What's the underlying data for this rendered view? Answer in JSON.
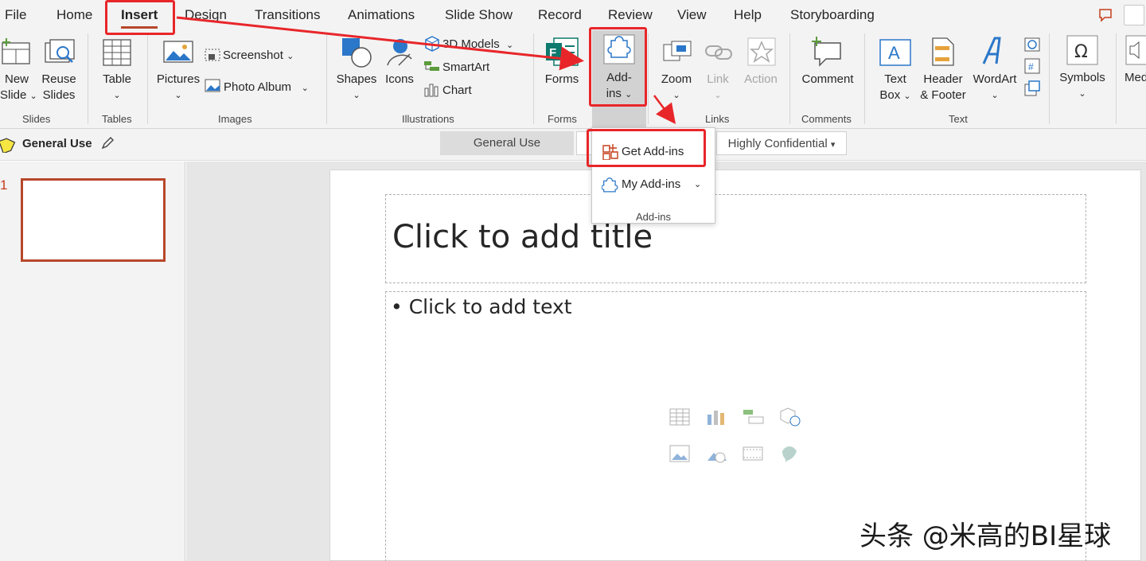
{
  "menubar": {
    "tabs": [
      "File",
      "Home",
      "Insert",
      "Design",
      "Transitions",
      "Animations",
      "Slide Show",
      "Record",
      "Review",
      "View",
      "Help",
      "Storyboarding"
    ],
    "active_tab": "Insert"
  },
  "ribbon": {
    "slides": {
      "new_slide": [
        "New",
        "Slide"
      ],
      "reuse_slides": [
        "Reuse",
        "Slides"
      ],
      "group": "Slides"
    },
    "tables": {
      "table": "Table",
      "group": "Tables"
    },
    "images": {
      "pictures": "Pictures",
      "screenshot": "Screenshot",
      "photo_album": "Photo Album",
      "group": "Images"
    },
    "illustrations": {
      "shapes": "Shapes",
      "icons": "Icons",
      "models_3d": "3D Models",
      "smartart": "SmartArt",
      "chart": "Chart",
      "group": "Illustrations"
    },
    "forms": {
      "forms": "Forms",
      "group": "Forms"
    },
    "addins": {
      "label": [
        "Add-",
        "ins"
      ]
    },
    "links": {
      "zoom": "Zoom",
      "link": "Link",
      "action": "Action",
      "group": "Links"
    },
    "comments": {
      "comment": "Comment",
      "group": "Comments"
    },
    "text": {
      "text_box": [
        "Text",
        "Box"
      ],
      "header_footer": [
        "Header",
        "& Footer"
      ],
      "wordart": "WordArt",
      "group": "Text"
    },
    "symbols": {
      "symbols": "Symbols",
      "media": "Med"
    }
  },
  "sensitivity": {
    "label": "General Use",
    "options": [
      "General Use",
      "Highly Confidential"
    ]
  },
  "addins_menu": {
    "items": [
      "Get Add-ins",
      "My Add-ins"
    ],
    "group": "Add-ins"
  },
  "thumbnails": {
    "slide_number": "1"
  },
  "slide": {
    "title_placeholder": "Click to add title",
    "body_placeholder": "Click to add text"
  },
  "watermark": "头条 @米高的BI星球",
  "colors": {
    "accent": "#b7472a",
    "highlight": "#e8262a",
    "ribbon_bg": "#f3f3f3"
  }
}
